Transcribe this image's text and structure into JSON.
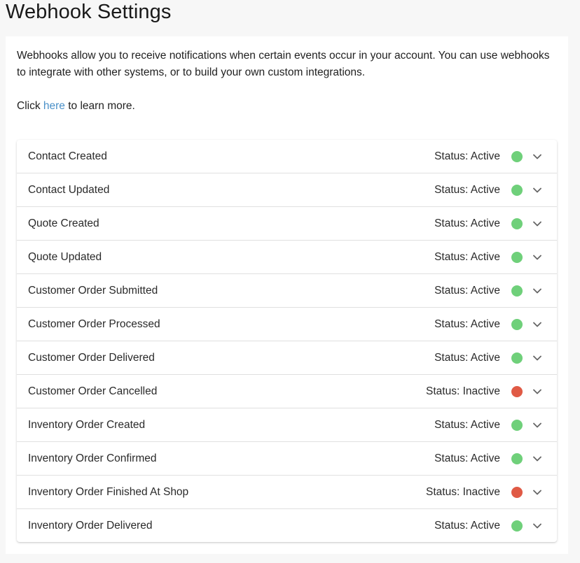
{
  "page": {
    "title": "Webhook Settings"
  },
  "intro": {
    "text_1": "Webhooks allow you to receive notifications when certain events occur in your account. You can use webhooks to integrate with other systems, or to build your own custom integrations.",
    "click_prefix": "Click ",
    "link_label": "here",
    "click_suffix": " to learn more."
  },
  "colors": {
    "active": "#6fd07a",
    "inactive": "#e05a45",
    "link": "#4a90c8"
  },
  "webhooks": [
    {
      "name": "Contact Created",
      "status": "Status: Active",
      "state": "active"
    },
    {
      "name": "Contact Updated",
      "status": "Status: Active",
      "state": "active"
    },
    {
      "name": "Quote Created",
      "status": "Status: Active",
      "state": "active"
    },
    {
      "name": "Quote Updated",
      "status": "Status: Active",
      "state": "active"
    },
    {
      "name": "Customer Order Submitted",
      "status": "Status: Active",
      "state": "active"
    },
    {
      "name": "Customer Order Processed",
      "status": "Status: Active",
      "state": "active"
    },
    {
      "name": "Customer Order Delivered",
      "status": "Status: Active",
      "state": "active"
    },
    {
      "name": "Customer Order Cancelled",
      "status": "Status: Inactive",
      "state": "inactive"
    },
    {
      "name": "Inventory Order Created",
      "status": "Status: Active",
      "state": "active"
    },
    {
      "name": "Inventory Order Confirmed",
      "status": "Status: Active",
      "state": "active"
    },
    {
      "name": "Inventory Order Finished At Shop",
      "status": "Status: Inactive",
      "state": "inactive"
    },
    {
      "name": "Inventory Order Delivered",
      "status": "Status: Active",
      "state": "active"
    }
  ]
}
